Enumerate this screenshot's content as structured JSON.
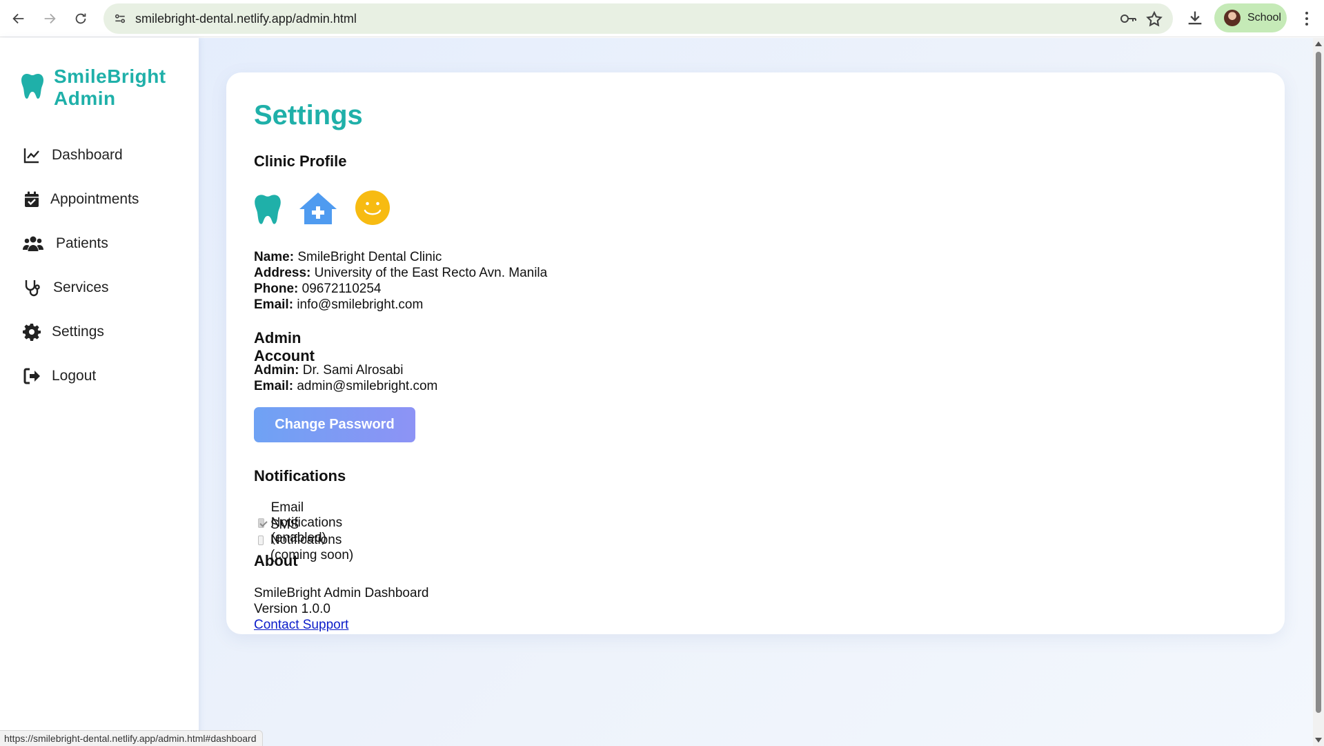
{
  "browser": {
    "url": "smilebright-dental.netlify.app/admin.html",
    "profile_label": "School",
    "status_url": "https://smilebright-dental.netlify.app/admin.html#dashboard"
  },
  "sidebar": {
    "brand": "SmileBright Admin",
    "items": [
      {
        "label": "Dashboard",
        "icon": "chart-line-icon"
      },
      {
        "label": "Appointments",
        "icon": "calendar-check-icon"
      },
      {
        "label": "Patients",
        "icon": "users-icon"
      },
      {
        "label": "Services",
        "icon": "stethoscope-icon"
      },
      {
        "label": "Settings",
        "icon": "gear-icon"
      },
      {
        "label": "Logout",
        "icon": "sign-out-icon"
      }
    ]
  },
  "settings": {
    "title": "Settings",
    "clinic_profile": {
      "heading": "Clinic Profile",
      "icons": [
        "tooth-icon",
        "clinic-house-icon",
        "smiley-icon"
      ],
      "name_label": "Name:",
      "name": "SmileBright Dental Clinic",
      "address_label": "Address:",
      "address": "University of the East Recto Avn. Manila",
      "phone_label": "Phone:",
      "phone": "09672110254",
      "email_label": "Email:",
      "email": "info@smilebright.com"
    },
    "admin_account": {
      "heading": "Admin Account",
      "admin_label": "Admin:",
      "admin": "Dr. Sami Alrosabi",
      "email_label": "Email:",
      "email": "admin@smilebright.com",
      "change_password_label": "Change Password"
    },
    "notifications": {
      "heading": "Notifications",
      "email_label": "Email Notifications (enabled)",
      "email_checked": true,
      "sms_label": "SMS Notifications (coming soon)",
      "sms_checked": false
    },
    "about": {
      "heading": "About",
      "app_name": "SmileBright Admin Dashboard",
      "version": "Version 1.0.0",
      "support_link": "Contact Support"
    }
  },
  "colors": {
    "brand": "#1fb0a9",
    "button_start": "#6fa2f4",
    "button_end": "#8d93f5",
    "house": "#4f9bf0",
    "smiley": "#f7bb12"
  }
}
